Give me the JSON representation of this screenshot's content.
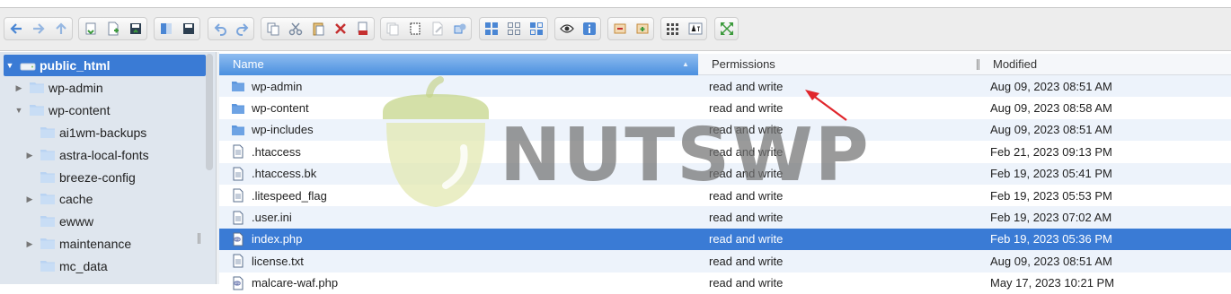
{
  "toolbar": {
    "groups": [
      {
        "buttons": [
          "back-icon",
          "forward-icon",
          "up-icon"
        ]
      },
      {
        "buttons": [
          "reload-icon",
          "new-file-icon",
          "save-icon"
        ]
      },
      {
        "buttons": [
          "open-icon",
          "save-as-icon"
        ]
      },
      {
        "buttons": [
          "undo-icon",
          "redo-icon"
        ]
      },
      {
        "buttons": [
          "copy-icon",
          "cut-icon",
          "paste-icon",
          "delete-icon",
          "rename-icon"
        ]
      },
      {
        "buttons": [
          "duplicate-icon",
          "select-icon",
          "edit-icon",
          "extract-icon"
        ]
      },
      {
        "buttons": [
          "icons-view-icon",
          "list-view-icon",
          "columns-view-icon"
        ]
      },
      {
        "buttons": [
          "preview-icon",
          "info-icon"
        ]
      },
      {
        "buttons": [
          "archive-icon",
          "unarchive-icon"
        ]
      },
      {
        "buttons": [
          "grid-icon",
          "translate-icon"
        ]
      },
      {
        "buttons": [
          "fullscreen-icon"
        ]
      }
    ]
  },
  "sidebar": {
    "items": [
      {
        "label": "public_html",
        "level": 0,
        "arrow": "expanded",
        "selected": true
      },
      {
        "label": "wp-admin",
        "level": 1,
        "arrow": "collapsed",
        "selected": false
      },
      {
        "label": "wp-content",
        "level": 1,
        "arrow": "expanded",
        "selected": false
      },
      {
        "label": "ai1wm-backups",
        "level": 2,
        "arrow": "none",
        "selected": false
      },
      {
        "label": "astra-local-fonts",
        "level": 2,
        "arrow": "collapsed",
        "selected": false
      },
      {
        "label": "breeze-config",
        "level": 2,
        "arrow": "none",
        "selected": false
      },
      {
        "label": "cache",
        "level": 2,
        "arrow": "collapsed",
        "selected": false
      },
      {
        "label": "ewww",
        "level": 2,
        "arrow": "none",
        "selected": false
      },
      {
        "label": "maintenance",
        "level": 2,
        "arrow": "collapsed",
        "selected": false
      },
      {
        "label": "mc_data",
        "level": 2,
        "arrow": "none",
        "selected": false
      }
    ]
  },
  "filelist": {
    "columns": {
      "name": "Name",
      "permissions": "Permissions",
      "modified": "Modified"
    },
    "rows": [
      {
        "name": "wp-admin",
        "type": "folder",
        "permissions": "read and write",
        "modified": "Aug 09, 2023 08:51 AM",
        "selected": false
      },
      {
        "name": "wp-content",
        "type": "folder",
        "permissions": "read and write",
        "modified": "Aug 09, 2023 08:58 AM",
        "selected": false
      },
      {
        "name": "wp-includes",
        "type": "folder",
        "permissions": "read and write",
        "modified": "Aug 09, 2023 08:51 AM",
        "selected": false
      },
      {
        "name": ".htaccess",
        "type": "file",
        "permissions": "read and write",
        "modified": "Feb 21, 2023 09:13 PM",
        "selected": false
      },
      {
        "name": ".htaccess.bk",
        "type": "file",
        "permissions": "read and write",
        "modified": "Feb 19, 2023 05:41 PM",
        "selected": false
      },
      {
        "name": ".litespeed_flag",
        "type": "file",
        "permissions": "read and write",
        "modified": "Feb 19, 2023 05:53 PM",
        "selected": false
      },
      {
        "name": ".user.ini",
        "type": "file",
        "permissions": "read and write",
        "modified": "Feb 19, 2023 07:02 AM",
        "selected": false
      },
      {
        "name": "index.php",
        "type": "php",
        "permissions": "read and write",
        "modified": "Feb 19, 2023 05:36 PM",
        "selected": true
      },
      {
        "name": "license.txt",
        "type": "file",
        "permissions": "read and write",
        "modified": "Aug 09, 2023 08:51 AM",
        "selected": false
      },
      {
        "name": "malcare-waf.php",
        "type": "php",
        "permissions": "read and write",
        "modified": "May 17, 2023 10:21 PM",
        "selected": false
      }
    ]
  },
  "watermark": {
    "text": "NUTSWP"
  },
  "colors": {
    "selection": "#3a7bd5",
    "folder": "#5b95dc",
    "sidebar_bg": "#dfe6ee",
    "row_alt": "#edf3fb",
    "annotation_arrow": "#e0262c"
  }
}
